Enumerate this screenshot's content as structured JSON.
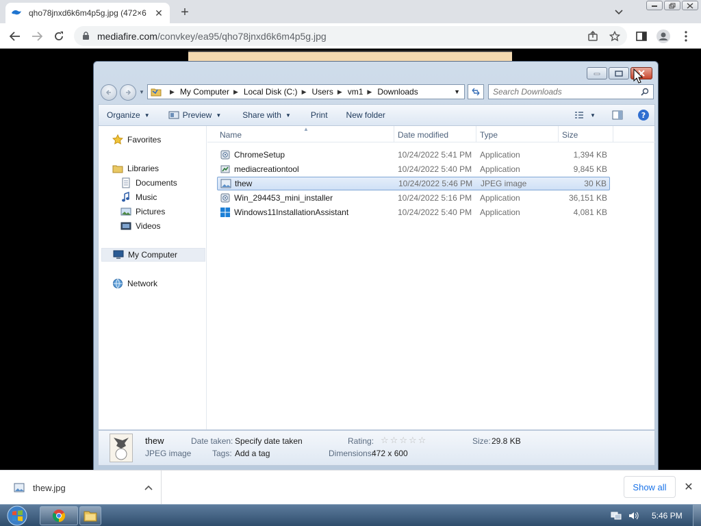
{
  "browser": {
    "tab_title": "qho78jnxd6k6m4p5g.jpg (472×6",
    "url_host": "mediafire.com",
    "url_path": "/convkey/ea95/qho78jnxd6k6m4p5g.jpg"
  },
  "explorer": {
    "breadcrumb": [
      "My Computer",
      "Local Disk (C:)",
      "Users",
      "vm1",
      "Downloads"
    ],
    "search_placeholder": "Search Downloads",
    "commands": {
      "organize": "Organize",
      "preview": "Preview",
      "share_with": "Share with",
      "print": "Print",
      "new_folder": "New folder"
    },
    "nav": {
      "favorites": "Favorites",
      "libraries": "Libraries",
      "documents": "Documents",
      "music": "Music",
      "pictures": "Pictures",
      "videos": "Videos",
      "my_computer": "My Computer",
      "network": "Network"
    },
    "columns": {
      "name": "Name",
      "date_modified": "Date modified",
      "type": "Type",
      "size": "Size"
    },
    "files": [
      {
        "name": "ChromeSetup",
        "date": "10/24/2022 5:41 PM",
        "type": "Application",
        "size": "1,394 KB",
        "icon": "installer-icon"
      },
      {
        "name": "mediacreationtool",
        "date": "10/24/2022 5:40 PM",
        "type": "Application",
        "size": "9,845 KB",
        "icon": "media-tool-icon"
      },
      {
        "name": "thew",
        "date": "10/24/2022 5:46 PM",
        "type": "JPEG image",
        "size": "30 KB",
        "icon": "jpeg-icon"
      },
      {
        "name": "Win_294453_mini_installer",
        "date": "10/24/2022 5:16 PM",
        "type": "Application",
        "size": "36,151 KB",
        "icon": "installer-icon"
      },
      {
        "name": "Windows11InstallationAssistant",
        "date": "10/24/2022 5:40 PM",
        "type": "Application",
        "size": "4,081 KB",
        "icon": "windows-logo-icon"
      }
    ],
    "selected_index": 2,
    "details": {
      "name": "thew",
      "type": "JPEG image",
      "date_taken_label": "Date taken:",
      "date_taken_value": "Specify date taken",
      "tags_label": "Tags:",
      "tags_value": "Add a tag",
      "rating_label": "Rating:",
      "rating_value": 0,
      "rating_max": 5,
      "dimensions_label": "Dimensions:",
      "dimensions_value": "472 x 600",
      "size_label": "Size:",
      "size_value": "29.8 KB"
    }
  },
  "downloads": {
    "file": "thew.jpg",
    "show_all": "Show all"
  },
  "taskbar": {
    "clock": "5:46 PM"
  },
  "colors": {
    "chrome_blue": "#1a73e8",
    "selection_border": "#7ea6d6",
    "taskbar": "#3e5d7d"
  }
}
